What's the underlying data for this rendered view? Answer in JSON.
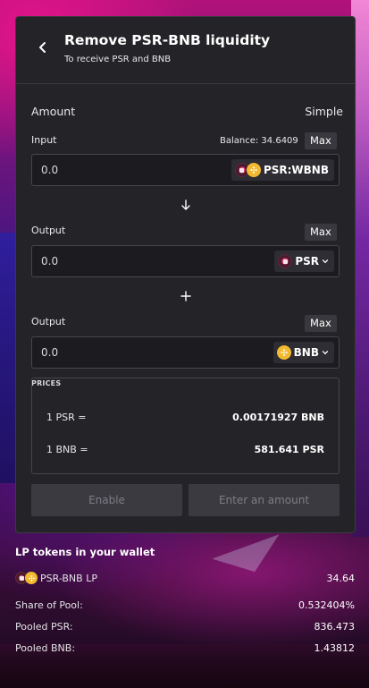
{
  "header": {
    "title": "Remove PSR-BNB liquidity",
    "subtitle": "To receive PSR and BNB"
  },
  "amount": {
    "label": "Amount",
    "mode": "Simple"
  },
  "input": {
    "label": "Input",
    "balance": "Balance: 34.6409",
    "max_label": "Max",
    "value": "0.0",
    "token": "PSR:WBNB",
    "token_icons": [
      "psr-coin-icon",
      "bnb-coin-icon"
    ]
  },
  "output1": {
    "label": "Output",
    "max_label": "Max",
    "value": "0.0",
    "token": "PSR",
    "token_icon": "psr-coin-icon"
  },
  "output2": {
    "label": "Output",
    "max_label": "Max",
    "value": "0.0",
    "token": "BNB",
    "token_icon": "bnb-coin-icon"
  },
  "prices": {
    "label": "PRICES",
    "rows": [
      {
        "key": "1 PSR =",
        "value": "0.00171927 BNB"
      },
      {
        "key": "1 BNB =",
        "value": "581.641 PSR"
      }
    ]
  },
  "buttons": {
    "enable": "Enable",
    "enter_amount": "Enter an amount"
  },
  "lp": {
    "title": "LP tokens in your wallet",
    "rows": [
      {
        "key": "PSR-BNB LP",
        "value": "34.64"
      },
      {
        "key": "Share of Pool:",
        "value": "0.532404%"
      },
      {
        "key": "Pooled PSR:",
        "value": "836.473"
      },
      {
        "key": "Pooled BNB:",
        "value": "1.43812"
      }
    ]
  },
  "colors": {
    "card_bg": "#242428",
    "field_bg": "#1c1c20",
    "bnb": "#f3ba2f",
    "psr": "#e1457a"
  }
}
